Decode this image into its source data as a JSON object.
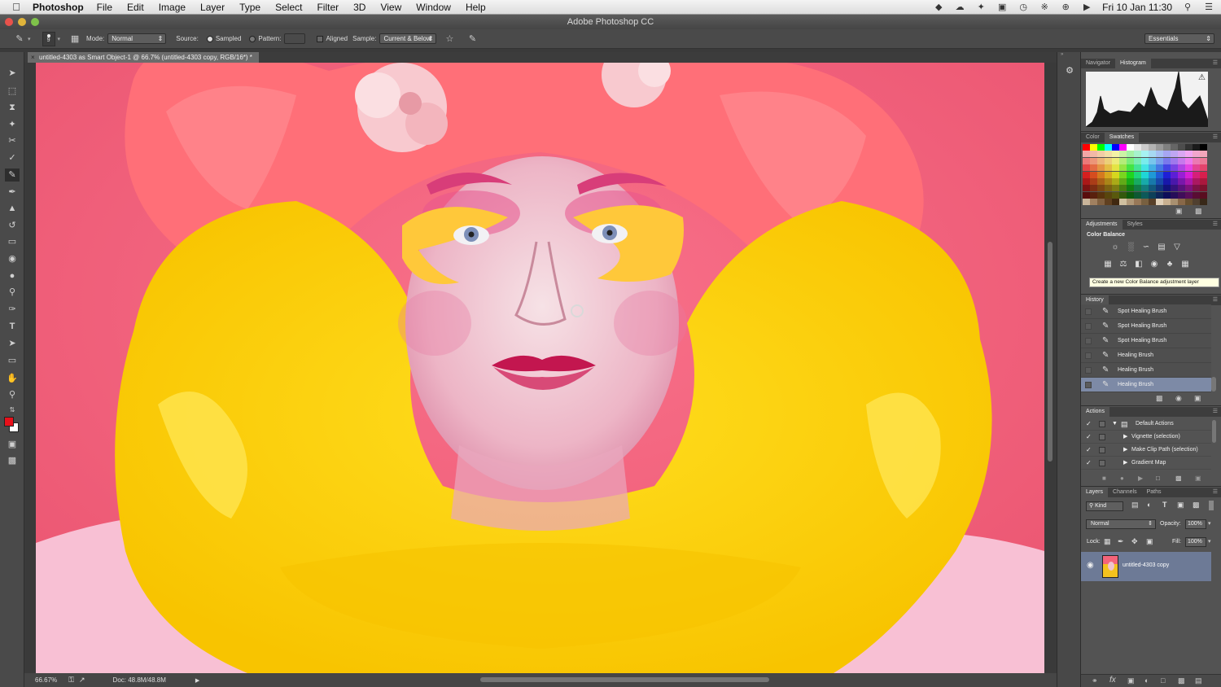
{
  "menubar": {
    "app_name": "Photoshop",
    "menus": [
      "File",
      "Edit",
      "Image",
      "Layer",
      "Type",
      "Select",
      "Filter",
      "3D",
      "View",
      "Window",
      "Help"
    ],
    "clock": "Fri 10 Jan  11:30"
  },
  "window": {
    "title": "Adobe Photoshop CC"
  },
  "options": {
    "brush_size": "9",
    "mode_label": "Mode:",
    "mode_value": "Normal",
    "source_label": "Source:",
    "sampled_label": "Sampled",
    "pattern_label": "Pattern:",
    "aligned_label": "Aligned",
    "sample_label": "Sample:",
    "sample_value": "Current & Below",
    "workspace": "Essentials"
  },
  "document": {
    "tab_title": "untitled-4303 as Smart Object-1 @ 66.7% (untitled-4303 copy, RGB/16*) *",
    "zoom": "66.67%",
    "doc_size": "Doc: 48.8M/48.8M"
  },
  "colors": {
    "foreground": "#e8101a",
    "background": "#ffffff",
    "backdrop": "#f0607c",
    "ruffle": "#ffd200",
    "wig": "#ff6f78"
  },
  "panels": {
    "navigator_tab": "Navigator",
    "histogram_tab": "Histogram",
    "color_tab": "Color",
    "swatches_tab": "Swatches",
    "adjustments_tab": "Adjustments",
    "styles_tab": "Styles",
    "adjustments_heading": "Color Balance",
    "adjustments_tooltip": "Create a new Color Balance adjustment layer",
    "history_tab": "History",
    "history": [
      {
        "label": "Spot Healing Brush"
      },
      {
        "label": "Spot Healing Brush"
      },
      {
        "label": "Spot Healing Brush"
      },
      {
        "label": "Healing Brush"
      },
      {
        "label": "Healing Brush"
      },
      {
        "label": "Healing Brush",
        "selected": true
      }
    ],
    "actions_tab": "Actions",
    "actions": [
      {
        "label": "Default Actions",
        "type": "set"
      },
      {
        "label": "Vignette (selection)",
        "type": "action"
      },
      {
        "label": "Make Clip Path (selection)",
        "type": "action"
      },
      {
        "label": "Gradient Map",
        "type": "action"
      }
    ],
    "layers_tab": "Layers",
    "channels_tab": "Channels",
    "paths_tab": "Paths",
    "kind_filter": "Kind",
    "blend_mode": "Normal",
    "opacity_label": "Opacity:",
    "opacity_value": "100%",
    "lock_label": "Lock:",
    "fill_label": "Fill:",
    "fill_value": "100%",
    "layer_name": "untitled-4303 copy"
  }
}
